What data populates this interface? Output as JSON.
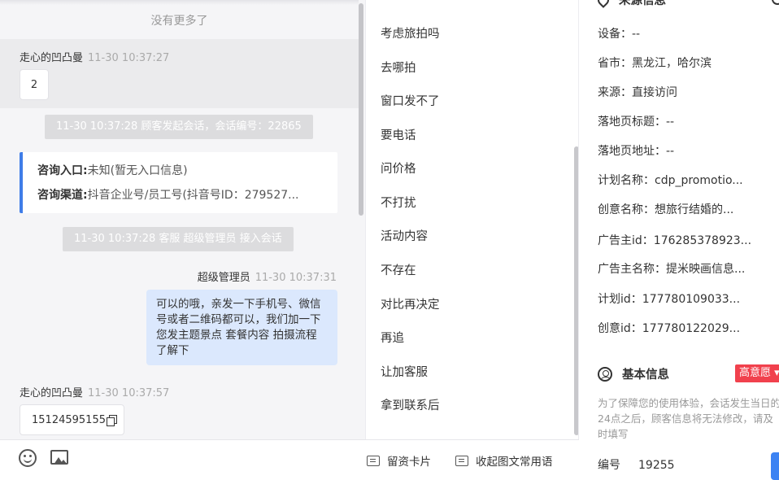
{
  "chat": {
    "no_more": "没有更多了",
    "msg1": {
      "sender": "走心的凹凸曼",
      "time": "11-30 10:37:27",
      "text": "2"
    },
    "sys1": "11-30 10:37:28 顾客发起会话，会话编号：22865",
    "entry": {
      "entry_label": "咨询入口:",
      "entry_value": "未知(暂无入口信息)",
      "channel_label": "咨询渠道:",
      "channel_value": "抖音企业号/员工号(抖音号ID：279527..."
    },
    "sys2": "11-30 10:37:28 客服 超级管理员 接入会话",
    "msg2": {
      "sender": "超级管理员",
      "time": "11-30 10:37:31",
      "text": "可以的哦，亲发一下手机号、微信号或者二维码都可以，我们加一下您发主题景点 套餐内容 拍摄流程了解下"
    },
    "msg3": {
      "sender": "走心的凹凸曼",
      "time": "11-30 10:37:57",
      "text": "15124595155"
    }
  },
  "phrases": [
    "考虑旅拍吗",
    "去哪拍",
    "窗口发不了",
    "要电话",
    "问价格",
    "不打扰",
    "活动内容",
    "不存在",
    "对比再决定",
    "再追",
    "让加客服",
    "拿到联系后"
  ],
  "toolbar": {
    "card_label": "留资卡片",
    "common_label": "收起图文常用语"
  },
  "info": {
    "source_title": "来源信息",
    "fields": [
      {
        "label": "设备：",
        "value": "--"
      },
      {
        "label": "省市：",
        "value": "黑龙江，哈尔滨"
      },
      {
        "label": "来源：",
        "value": "直接访问"
      },
      {
        "label": "落地页标题：",
        "value": "--"
      },
      {
        "label": "落地页地址：",
        "value": "--"
      },
      {
        "label": "计划名称：",
        "value": "cdp_promotio..."
      },
      {
        "label": "创意名称：",
        "value": "想旅行结婚的..."
      },
      {
        "label": "广告主id：",
        "value": "176285378923..."
      },
      {
        "label": "广告主名称：",
        "value": "提米映画信息..."
      },
      {
        "label": "计划id：",
        "value": "177780109033..."
      },
      {
        "label": "创意id：",
        "value": "177780122029..."
      }
    ],
    "basic_title": "基本信息",
    "intent_tag": "高意愿",
    "notice": "为了保障您的使用体验，会话发生当日的24点之后，顾客信息将无法修改，请及时填写",
    "id_label": "编号",
    "id_value": "19255"
  }
}
